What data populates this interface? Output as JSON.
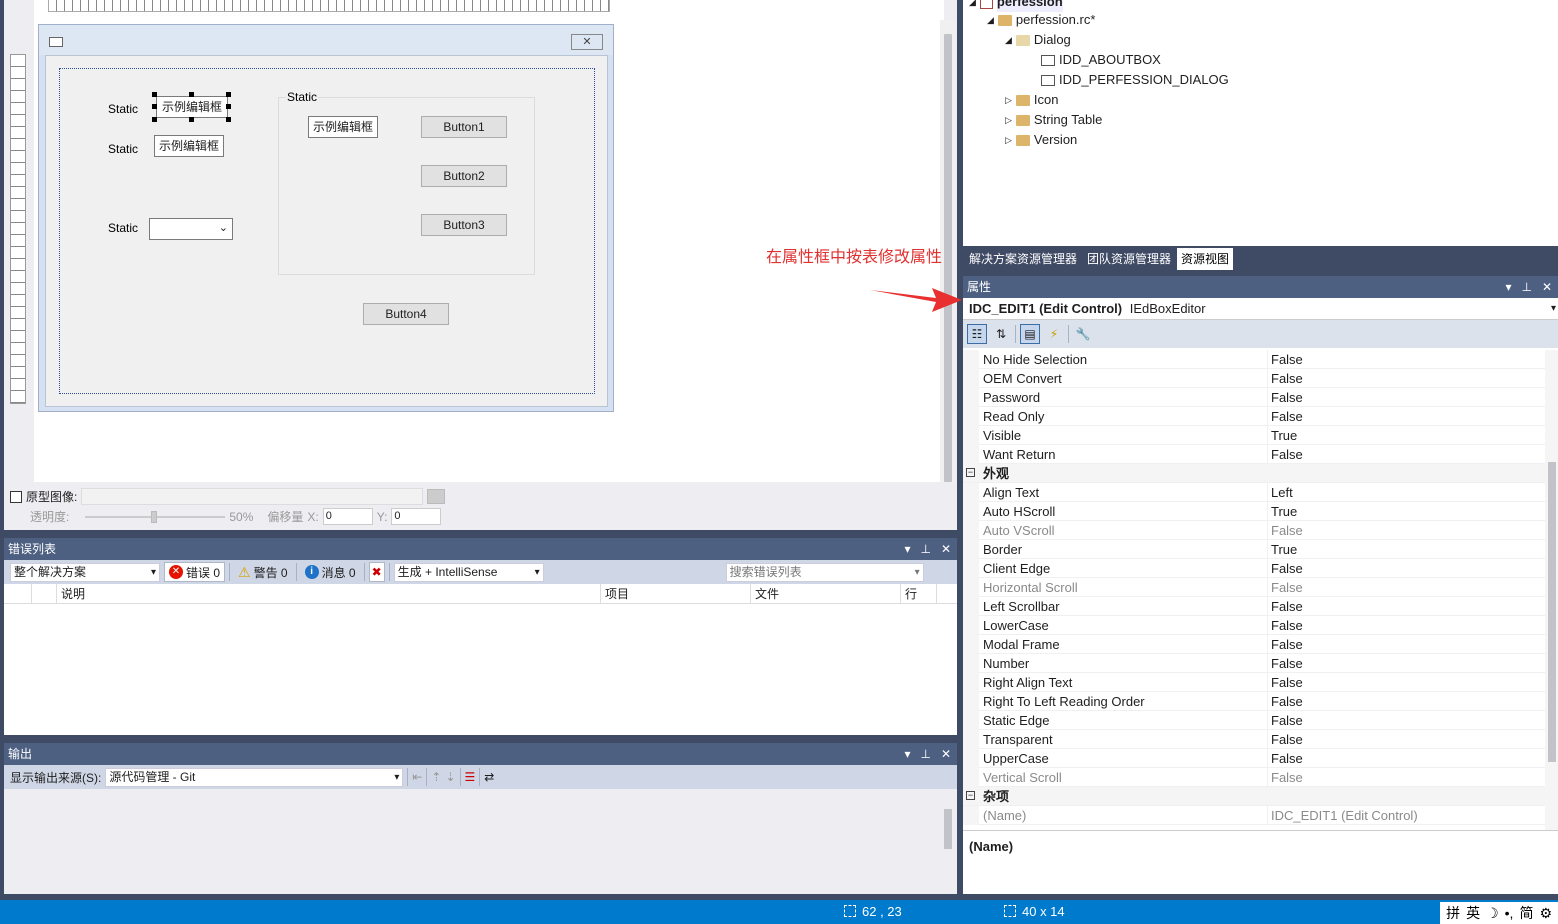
{
  "designer": {
    "dialog": {
      "labels": [
        "Static",
        "Static",
        "Static"
      ],
      "edit1": "示例编辑框",
      "edit2": "示例编辑框",
      "group_caption": "Static",
      "group_edit": "示例编辑框",
      "buttons": [
        "Button1",
        "Button2",
        "Button3",
        "Button4"
      ]
    },
    "prototype": {
      "checkbox_label": "原型图像:",
      "opacity_label": "透明度:",
      "opacity_value": "50%",
      "offset_label": "偏移量",
      "x_label": "X:",
      "x_value": "0",
      "y_label": "Y:",
      "y_value": "0"
    }
  },
  "annotation": "在属性框中按表修改属性",
  "error_list": {
    "title": "错误列表",
    "scope": "整个解决方案",
    "errors": "错误 0",
    "warnings": "警告 0",
    "messages": "消息 0",
    "build_filter": "生成 + IntelliSense",
    "search_placeholder": "搜索错误列表",
    "columns": [
      "说明",
      "项目",
      "文件",
      "行"
    ]
  },
  "output": {
    "title": "输出",
    "source_label": "显示输出来源(S):",
    "source_value": "源代码管理 - Git"
  },
  "resource_tree": {
    "items": [
      {
        "label": "perfession",
        "level": 0
      },
      {
        "label": "perfession.rc*",
        "level": 1
      },
      {
        "label": "Dialog",
        "level": 2
      },
      {
        "label": "IDD_ABOUTBOX",
        "level": 3
      },
      {
        "label": "IDD_PERFESSION_DIALOG",
        "level": 3
      },
      {
        "label": "Icon",
        "level": 2
      },
      {
        "label": "String Table",
        "level": 2
      },
      {
        "label": "Version",
        "level": 2
      }
    ]
  },
  "tabs": [
    "解决方案资源管理器",
    "团队资源管理器",
    "资源视图"
  ],
  "properties": {
    "title": "属性",
    "object_bold": "IDC_EDIT1 (Edit Control)",
    "object_type": "IEdBoxEditor",
    "rows": [
      {
        "name": "No Hide Selection",
        "value": "False"
      },
      {
        "name": "OEM Convert",
        "value": "False"
      },
      {
        "name": "Password",
        "value": "False"
      },
      {
        "name": "Read Only",
        "value": "False"
      },
      {
        "name": "Visible",
        "value": "True"
      },
      {
        "name": "Want Return",
        "value": "False"
      },
      {
        "name": "外观",
        "category": true
      },
      {
        "name": "Align Text",
        "value": "Left"
      },
      {
        "name": "Auto HScroll",
        "value": "True"
      },
      {
        "name": "Auto VScroll",
        "value": "False",
        "gray": true
      },
      {
        "name": "Border",
        "value": "True"
      },
      {
        "name": "Client Edge",
        "value": "False"
      },
      {
        "name": "Horizontal Scroll",
        "value": "False",
        "gray": true
      },
      {
        "name": "Left Scrollbar",
        "value": "False"
      },
      {
        "name": "LowerCase",
        "value": "False"
      },
      {
        "name": "Modal Frame",
        "value": "False"
      },
      {
        "name": "Number",
        "value": "False"
      },
      {
        "name": "Right Align Text",
        "value": "False"
      },
      {
        "name": "Right To Left Reading Order",
        "value": "False"
      },
      {
        "name": "Static Edge",
        "value": "False"
      },
      {
        "name": "Transparent",
        "value": "False"
      },
      {
        "name": "UpperCase",
        "value": "False"
      },
      {
        "name": "Vertical Scroll",
        "value": "False",
        "gray": true
      },
      {
        "name": "杂项",
        "category": true
      },
      {
        "name": "(Name)",
        "value": "IDC_EDIT1 (Edit Control)",
        "gray": true
      }
    ],
    "description_title": "(Name)"
  },
  "status": {
    "position": "62 , 23",
    "size": "40 x 14",
    "ime": [
      "拼",
      "英",
      "☽",
      "•,",
      "简",
      "⚙"
    ]
  },
  "colors": {
    "accent": "#007acc",
    "panel_title": "#4d6082",
    "annotation": "#e03030"
  }
}
